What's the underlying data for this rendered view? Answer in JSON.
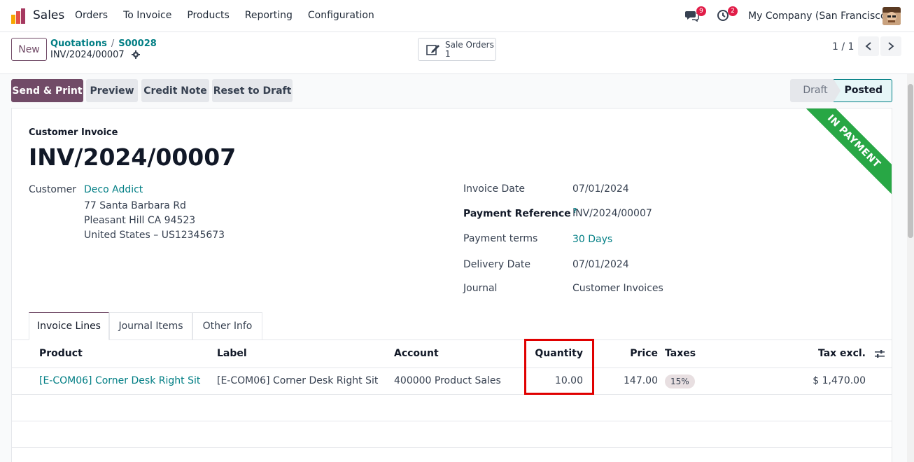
{
  "navbar": {
    "app_name": "Sales",
    "menu": [
      "Orders",
      "To Invoice",
      "Products",
      "Reporting",
      "Configuration"
    ],
    "messages_count": "9",
    "activities_count": "2",
    "company": "My Company (San Francisco)"
  },
  "control": {
    "new_label": "New",
    "breadcrumb": [
      "Quotations",
      "S00028"
    ],
    "breadcrumb_sep": "/",
    "record_name": "INV/2024/00007",
    "smart_button": {
      "label": "Sale Orders",
      "count": "1"
    },
    "pager": "1 / 1"
  },
  "actions": {
    "send_print": "Send & Print",
    "preview": "Preview",
    "credit_note": "Credit Note",
    "reset_draft": "Reset to Draft"
  },
  "status": {
    "draft": "Draft",
    "posted": "Posted"
  },
  "invoice": {
    "ribbon": "IN PAYMENT",
    "type": "Customer Invoice",
    "number": "INV/2024/00007",
    "customer_label": "Customer",
    "customer_name": "Deco Addict",
    "address": [
      "77 Santa Barbara Rd",
      "Pleasant Hill CA 94523",
      "United States – US12345673"
    ],
    "fields": {
      "invoice_date_label": "Invoice Date",
      "invoice_date": "07/01/2024",
      "payment_ref_label": "Payment Reference",
      "payment_ref_help": "?",
      "payment_ref": "INV/2024/00007",
      "payment_terms_label": "Payment terms",
      "payment_terms": "30 Days",
      "delivery_date_label": "Delivery Date",
      "delivery_date": "07/01/2024",
      "journal_label": "Journal",
      "journal": "Customer Invoices"
    }
  },
  "tabs": [
    "Invoice Lines",
    "Journal Items",
    "Other Info"
  ],
  "table": {
    "headers": {
      "product": "Product",
      "label": "Label",
      "account": "Account",
      "quantity": "Quantity",
      "price": "Price",
      "taxes": "Taxes",
      "tax_excl": "Tax excl."
    },
    "rows": [
      {
        "product": "[E-COM06] Corner Desk Right Sit",
        "label": "[E-COM06] Corner Desk Right Sit",
        "account": "400000 Product Sales",
        "quantity": "10.00",
        "price": "147.00",
        "tax": "15%",
        "tax_excl": "$ 1,470.00"
      }
    ]
  },
  "colors": {
    "brand": "#714b67",
    "link": "#017e84",
    "ribbon": "#28a745",
    "highlight": "#e00000"
  }
}
